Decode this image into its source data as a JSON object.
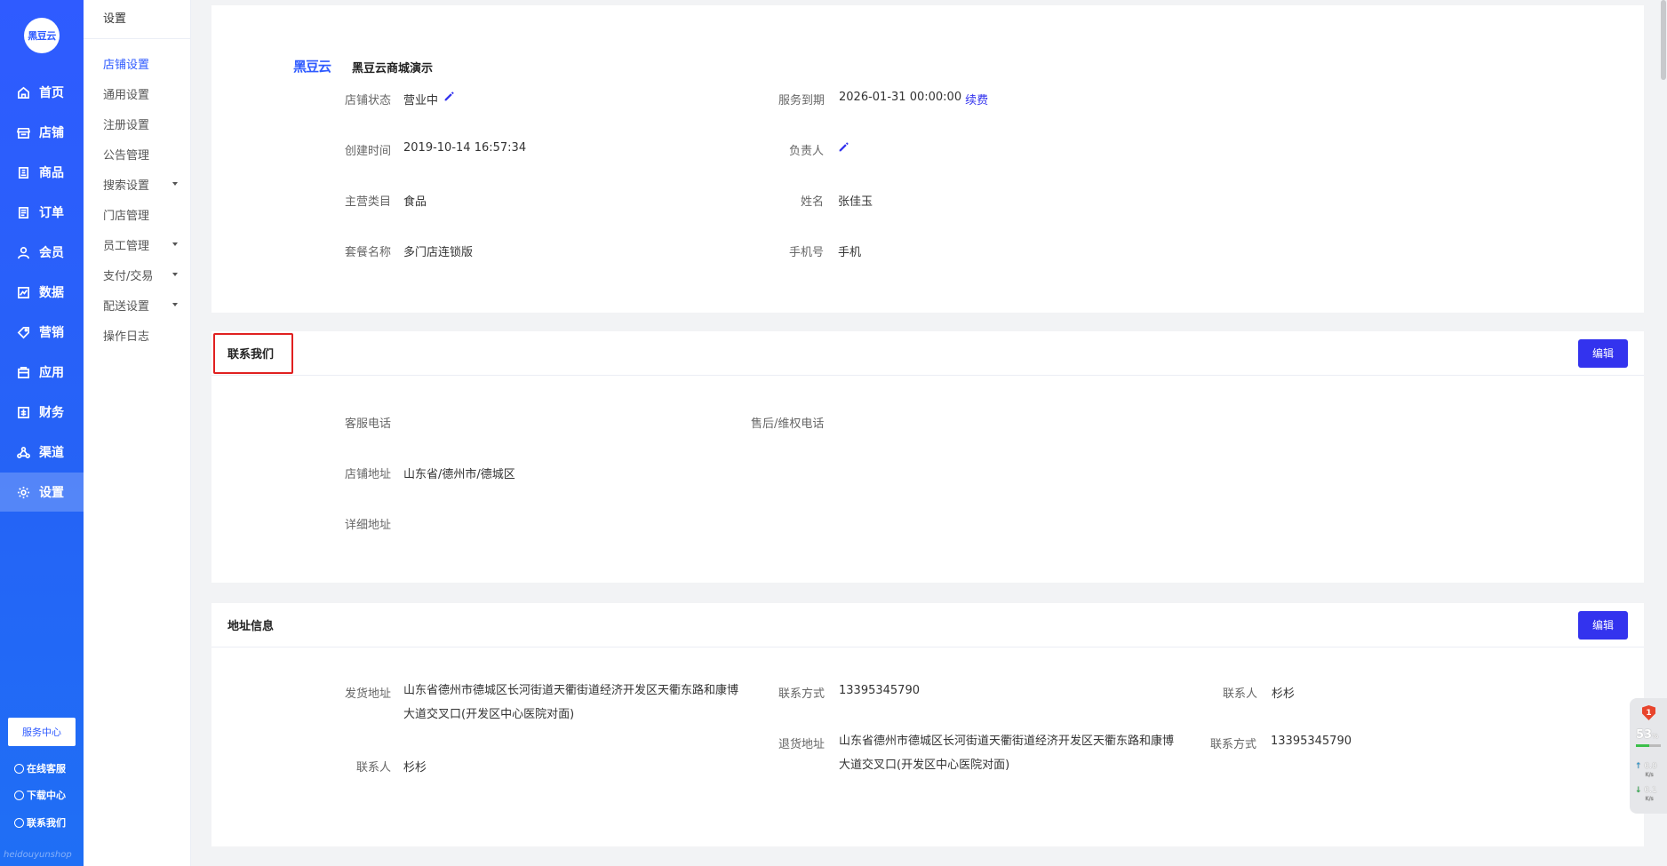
{
  "nav": {
    "logo": "黑豆云",
    "items": [
      {
        "label": "首页",
        "icon": "home-icon"
      },
      {
        "label": "店铺",
        "icon": "store-icon"
      },
      {
        "label": "商品",
        "icon": "goods-icon"
      },
      {
        "label": "订单",
        "icon": "order-icon"
      },
      {
        "label": "会员",
        "icon": "member-icon"
      },
      {
        "label": "数据",
        "icon": "chart-icon"
      },
      {
        "label": "营销",
        "icon": "tag-icon"
      },
      {
        "label": "应用",
        "icon": "app-icon"
      },
      {
        "label": "财务",
        "icon": "finance-icon"
      },
      {
        "label": "渠道",
        "icon": "channel-icon"
      },
      {
        "label": "设置",
        "icon": "gear-icon"
      }
    ],
    "active": "设置",
    "service_center": "服务中心",
    "footer": [
      "在线客服",
      "下载中心",
      "联系我们"
    ],
    "watermark": "heidouyunshop"
  },
  "subnav": {
    "title": "设置",
    "items": [
      {
        "label": "店铺设置"
      },
      {
        "label": "通用设置"
      },
      {
        "label": "注册设置"
      },
      {
        "label": "公告管理"
      },
      {
        "label": "搜索设置"
      },
      {
        "label": "门店管理"
      },
      {
        "label": "员工管理"
      },
      {
        "label": "支付/交易"
      },
      {
        "label": "配送设置"
      },
      {
        "label": "操作日志"
      }
    ]
  },
  "shop": {
    "brand": "黑豆云",
    "name": "黑豆云商城演示",
    "status_label": "店铺状态",
    "status_value": "营业中",
    "expire_label": "服务到期",
    "expire_value": "2026-01-31 00:00:00",
    "renew_link": "续费",
    "created_label": "创建时间",
    "created_value": "2019-10-14 16:57:34",
    "owner_label": "负责人",
    "category_label": "主营类目",
    "category_value": "食品",
    "name_label": "姓名",
    "name_value": "张佳玉",
    "package_label": "套餐名称",
    "package_value": "多门店连锁版",
    "phone_label": "手机号",
    "phone_value": "手机"
  },
  "contact": {
    "title": "联系我们",
    "edit": "编辑",
    "service_phone_label": "客服电话",
    "aftersale_phone_label": "售后/维权电话",
    "address_label": "店铺地址",
    "address_value": "山东省/德州市/德城区",
    "detail_label": "详细地址"
  },
  "address": {
    "title": "地址信息",
    "edit": "编辑",
    "ship_label": "发货地址",
    "ship_line1": "山东省德州市德城区长河街道天衢街道经济开发区天衢东路和康博",
    "ship_line2": "大道交叉口(开发区中心医院对面)",
    "contact_method_label": "联系方式",
    "contact_method_value": "13395345790",
    "contact_person_label": "联系人",
    "contact_person_value": "杉杉",
    "return_label": "退货地址",
    "return_line1": "山东省德州市德城区长河街道天衢街道经济开发区天衢东路和康博",
    "return_line2": "大道交叉口(开发区中心医院对面)",
    "return_contact_method_label": "联系方式",
    "return_contact_method_value": "13395345790",
    "left_contact_label": "联系人",
    "left_contact_value": "杉杉"
  },
  "widget": {
    "badge": "1",
    "percent": "53",
    "percent_unit": "%",
    "usage_fraction": 0.53,
    "up": "0.0",
    "down": "0.1",
    "unit": "K/s"
  }
}
